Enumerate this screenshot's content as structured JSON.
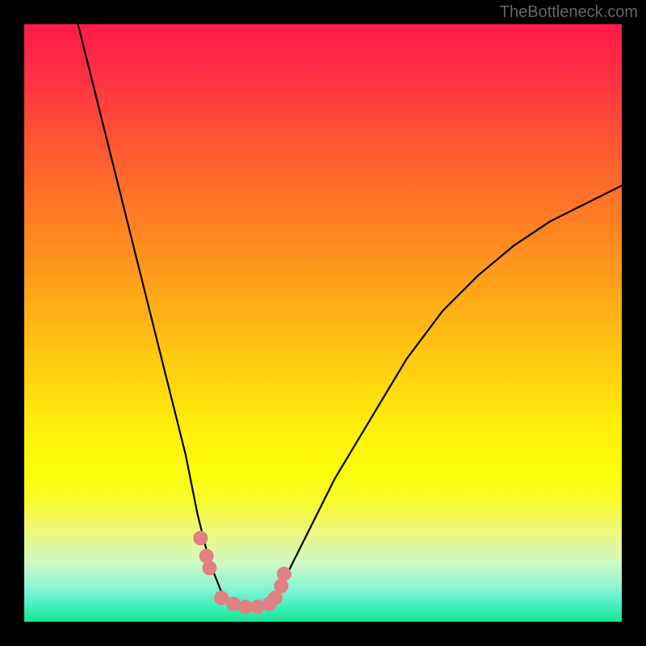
{
  "watermark": "TheBottleneck.com",
  "chart_data": {
    "type": "line",
    "title": "",
    "xlabel": "",
    "ylabel": "",
    "xlim": [
      0,
      100
    ],
    "ylim": [
      0,
      100
    ],
    "series": [
      {
        "name": "bottleneck-curve",
        "x": [
          9,
          12,
          15,
          18,
          21,
          24,
          27,
          29,
          31,
          33,
          35,
          37,
          39,
          41,
          43,
          47,
          52,
          58,
          64,
          70,
          76,
          82,
          88,
          94,
          100
        ],
        "values": [
          100,
          88,
          76,
          64,
          52,
          40,
          28,
          18,
          10,
          5,
          3,
          2,
          2,
          3,
          6,
          14,
          24,
          34,
          44,
          52,
          58,
          63,
          67,
          70,
          73
        ]
      }
    ],
    "markers": {
      "name": "bottom-highlight-dots",
      "color": "#e08080",
      "x": [
        29.5,
        30.5,
        31,
        33,
        35,
        37,
        39,
        41,
        42,
        43,
        43.5
      ],
      "values": [
        14,
        11,
        9,
        4,
        3,
        2.5,
        2.5,
        3,
        4,
        6,
        8
      ]
    },
    "gradient_stops": [
      {
        "pos": 0,
        "color": "#ff1a4a"
      },
      {
        "pos": 50,
        "color": "#ffc010"
      },
      {
        "pos": 80,
        "color": "#fcfc08"
      },
      {
        "pos": 100,
        "color": "#15e590"
      }
    ]
  }
}
